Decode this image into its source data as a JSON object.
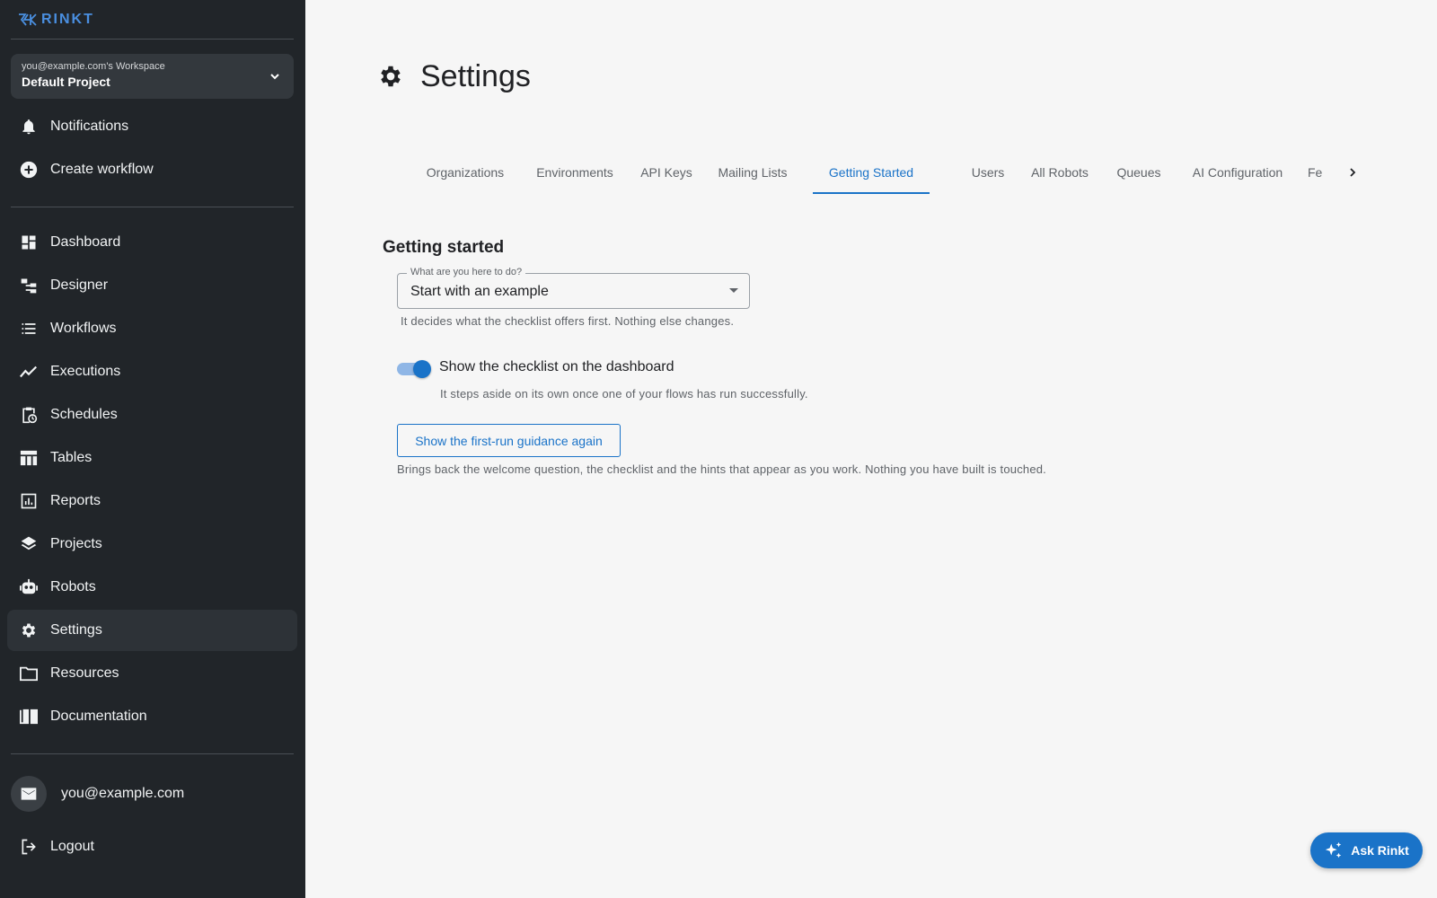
{
  "brand": {
    "logo_text": "RINKT"
  },
  "workspace": {
    "owner": "you@example.com's Workspace",
    "project": "Default Project"
  },
  "nav_top": [
    {
      "label": "Notifications",
      "icon": "bell-icon"
    },
    {
      "label": "Create workflow",
      "icon": "plus-circle-icon"
    }
  ],
  "nav_main": [
    {
      "label": "Dashboard",
      "icon": "dashboard-icon"
    },
    {
      "label": "Designer",
      "icon": "designer-icon"
    },
    {
      "label": "Workflows",
      "icon": "list-icon"
    },
    {
      "label": "Executions",
      "icon": "trend-line-icon"
    },
    {
      "label": "Schedules",
      "icon": "clipboard-clock-icon"
    },
    {
      "label": "Tables",
      "icon": "table-icon"
    },
    {
      "label": "Reports",
      "icon": "bar-chart-icon"
    },
    {
      "label": "Projects",
      "icon": "layers-icon"
    },
    {
      "label": "Robots",
      "icon": "robot-icon"
    },
    {
      "label": "Settings",
      "icon": "gear-icon",
      "active": true
    },
    {
      "label": "Resources",
      "icon": "folder-icon"
    },
    {
      "label": "Documentation",
      "icon": "book-icon"
    }
  ],
  "user": {
    "email": "you@example.com",
    "logout_label": "Logout"
  },
  "page": {
    "title": "Settings"
  },
  "tabs": [
    {
      "label": "Organizations"
    },
    {
      "label": "Environments"
    },
    {
      "label": "API Keys"
    },
    {
      "label": "Mailing Lists"
    },
    {
      "label": "Getting Started",
      "active": true
    },
    {
      "label": "Users"
    },
    {
      "label": "All Robots"
    },
    {
      "label": "Queues"
    },
    {
      "label": "AI Configuration"
    },
    {
      "label": "Fe"
    }
  ],
  "getting_started": {
    "title": "Getting started",
    "select_label": "What are you here to do?",
    "select_value": "Start with an example",
    "select_helper": "It decides what the checklist offers first. Nothing else changes.",
    "toggle_label": "Show the checklist on the dashboard",
    "toggle_on": true,
    "toggle_helper": "It steps aside on its own once one of your flows has run successfully.",
    "button_label": "Show the first-run guidance again",
    "button_helper": "Brings back the welcome question, the checklist and the hints that appear as you work. Nothing you have built is touched."
  },
  "assistant": {
    "label": "Ask Rinkt",
    "icon": "sparkle-icon"
  },
  "colors": {
    "sidebar_bg": "#212529",
    "accent": "#1a73c8",
    "page_bg": "#f6f6f6"
  }
}
